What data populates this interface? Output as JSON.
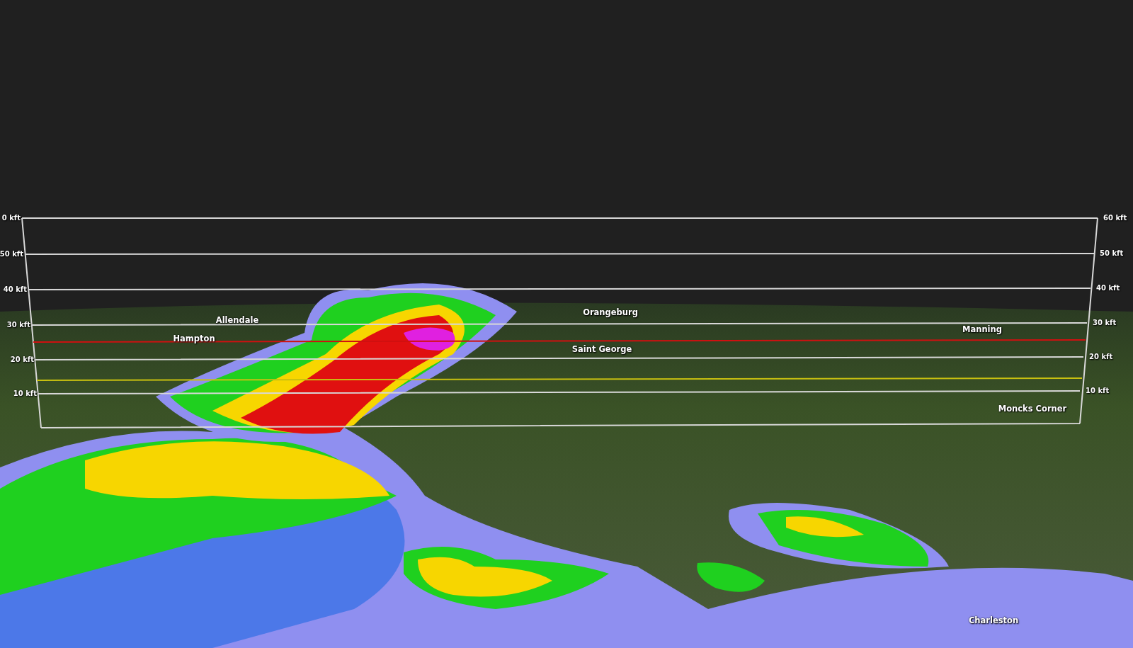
{
  "altitude_grid": {
    "levels": [
      {
        "left_label": "0 kft",
        "right_label": "60 kft"
      },
      {
        "left_label": "50 kft",
        "right_label": "50 kft"
      },
      {
        "left_label": "40 kft",
        "right_label": "40 kft"
      },
      {
        "left_label": "30 kft",
        "right_label": "30 kft"
      },
      {
        "left_label": "20 kft",
        "right_label": "20 kft"
      },
      {
        "left_label": "10 kft",
        "right_label": "10 kft"
      }
    ]
  },
  "map_labels": [
    {
      "name": "Allendale"
    },
    {
      "name": "Hampton"
    },
    {
      "name": "Orangeburg"
    },
    {
      "name": "Saint George"
    },
    {
      "name": "Manning"
    },
    {
      "name": "Moncks Corner"
    },
    {
      "name": "Charleston"
    }
  ]
}
